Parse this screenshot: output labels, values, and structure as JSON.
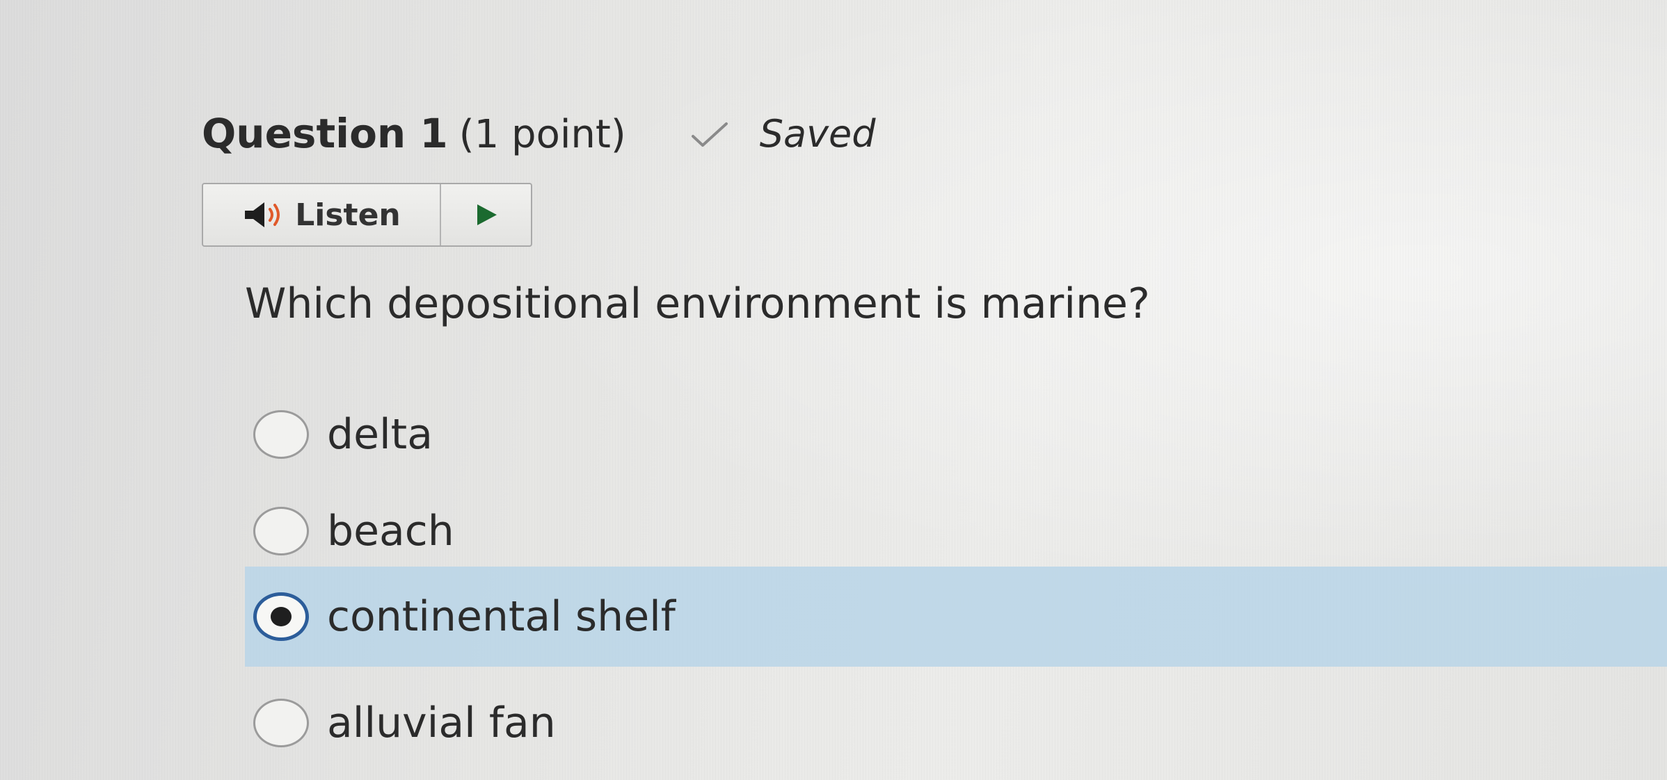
{
  "question": {
    "number_label": "Question 1",
    "points_label": "(1 point)",
    "status": {
      "icon": "checkmark-icon",
      "label": "Saved"
    }
  },
  "listen_widget": {
    "icon": "speaker-icon",
    "listen_label": "Listen",
    "play_icon": "play-icon"
  },
  "prompt": "Which depositional environment is marine?",
  "options": [
    {
      "label": "delta",
      "selected": false
    },
    {
      "label": "beach",
      "selected": false
    },
    {
      "label": "continental shelf",
      "selected": true
    },
    {
      "label": "alluvial fan",
      "selected": false
    }
  ],
  "colors": {
    "selected_row": "#b9d5e8",
    "selected_radio_ring": "#2c5d9a"
  }
}
